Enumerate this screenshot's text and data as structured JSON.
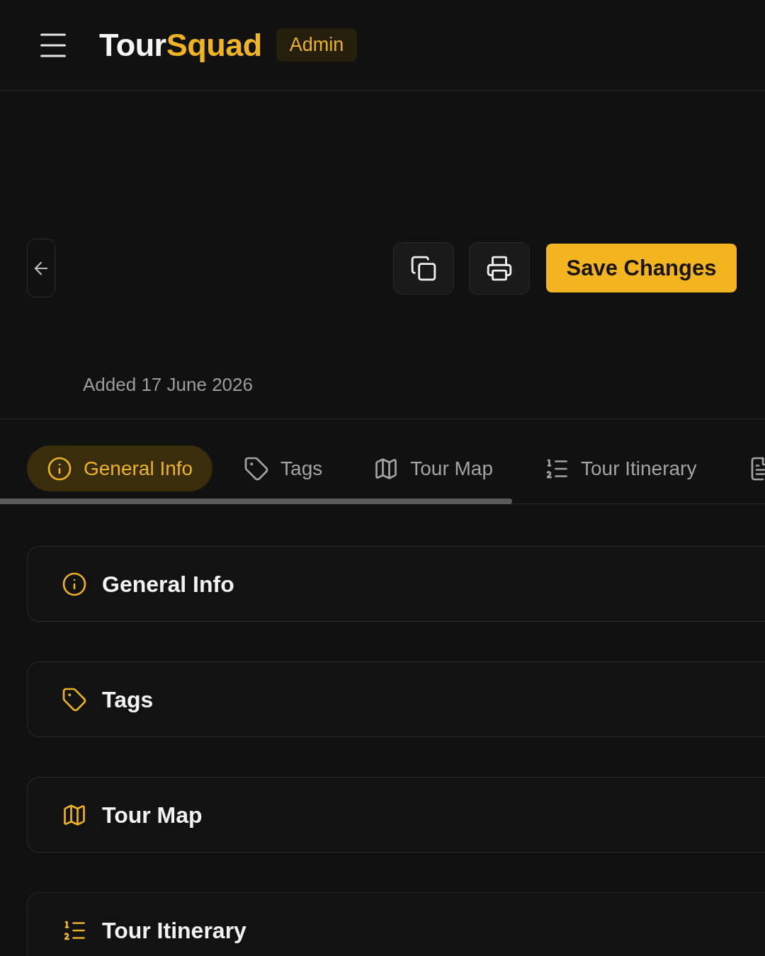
{
  "header": {
    "logo": {
      "primary": "Tour",
      "accent": "Squad"
    },
    "role_badge": "Admin"
  },
  "toolbar": {
    "save_button": "Save Changes"
  },
  "meta": {
    "added": "Added 17 June 2026"
  },
  "tabs": [
    {
      "label": "General Info",
      "selected": true
    },
    {
      "label": "Tags",
      "selected": false
    },
    {
      "label": "Tour Map",
      "selected": false
    },
    {
      "label": "Tour Itinerary",
      "selected": false
    },
    {
      "selected": false
    }
  ],
  "sections": [
    {
      "title": "General Info"
    },
    {
      "title": "Tags"
    },
    {
      "title": "Tour Map"
    },
    {
      "title": "Tour Itinerary"
    }
  ]
}
